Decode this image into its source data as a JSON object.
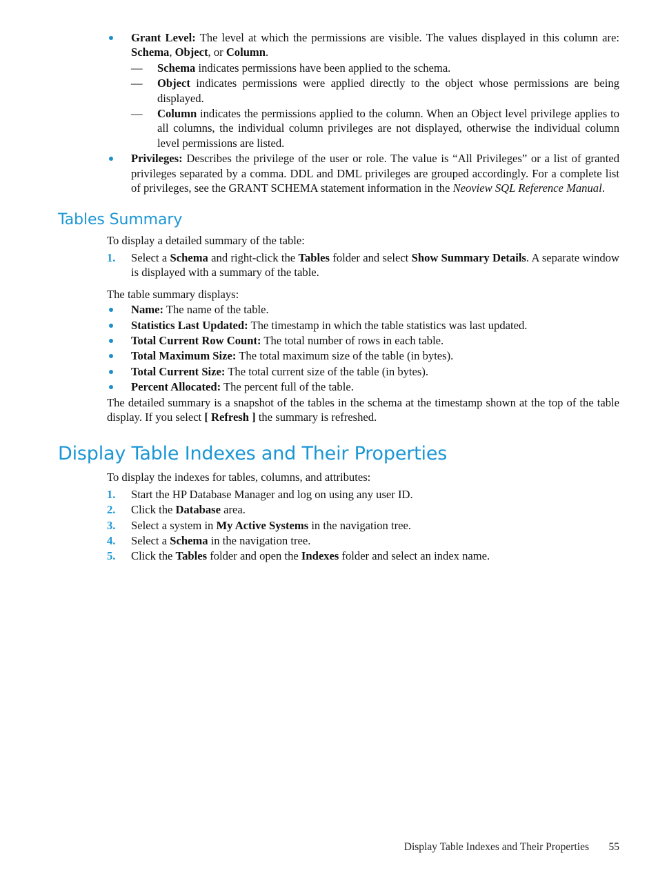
{
  "colors": {
    "heading": "#1b96d4",
    "bullet": "#1b8fcc",
    "number": "#1b96d4",
    "body_text": "#111111"
  },
  "section_permissions": {
    "bullets": [
      {
        "term": "Grant Level:",
        "text_1": " The level at which the permissions are visible. The values displayed in this column are: ",
        "bold_1": "Schema",
        "text_2": ", ",
        "bold_2": "Object",
        "text_3": ", or ",
        "bold_3": "Column",
        "text_4": "."
      }
    ],
    "sub_bullets": [
      {
        "marker": "—",
        "term": "Schema",
        "text": " indicates permissions have been applied to the schema."
      },
      {
        "marker": "—",
        "term": "Object",
        "text": " indicates permissions were applied directly to the object whose permissions are being displayed."
      },
      {
        "marker": "—",
        "term": "Column",
        "text": " indicates the permissions applied to the column. When an Object level privilege applies to all columns, the individual column privileges are not displayed, otherwise the individual column level permissions are listed."
      }
    ],
    "privileges_bullet": {
      "term": "Privileges:",
      "text_1": " Describes the privilege of the user or role. The value is “All Privileges” or a list of granted privileges separated by a comma. DDL and DML privileges are grouped accordingly. For a complete list of privileges, see the GRANT SCHEMA statement information in the ",
      "italic_1": "Neoview SQL Reference Manual",
      "text_2": "."
    }
  },
  "tables_summary": {
    "heading": "Tables Summary",
    "intro": "To display a detailed summary of the table:",
    "steps": [
      {
        "marker": "1.",
        "text_1": "Select a ",
        "bold_1": "Schema",
        "text_2": " and right-click the ",
        "bold_2": "Tables",
        "text_3": " folder and select ",
        "bold_3": "Show Summary Details",
        "text_4": ". A separate window is displayed with a summary of the table."
      }
    ],
    "displays_intro": "The table summary displays:",
    "display_items": [
      {
        "term": "Name:",
        "text": " The name of the table."
      },
      {
        "term": "Statistics Last Updated:",
        "text": " The timestamp in which the table statistics was last updated."
      },
      {
        "term": "Total Current Row Count:",
        "text": " The total number of rows in each table."
      },
      {
        "term": "Total Maximum Size:",
        "text": " The total maximum size of the table (in bytes)."
      },
      {
        "term": "Total Current Size:",
        "text": " The total current size of the table (in bytes)."
      },
      {
        "term": "Percent Allocated:",
        "text": " The percent full of the table."
      }
    ],
    "outro": {
      "text_1": "The detailed summary is a snapshot of the tables in the schema at the timestamp shown at the top of the table display. If you select ",
      "bold_1": "[ Refresh ]",
      "text_2": " the summary is refreshed."
    }
  },
  "display_indexes": {
    "heading": "Display Table Indexes and Their Properties",
    "intro": "To display the indexes for tables, columns, and attributes:",
    "steps": [
      {
        "marker": "1.",
        "text_1": "Start the HP Database Manager and log on using any user ID.",
        "bold_1": "",
        "text_2": ""
      },
      {
        "marker": "2.",
        "text_1": "Click the ",
        "bold_1": "Database",
        "text_2": " area."
      },
      {
        "marker": "3.",
        "text_1": "Select a system in ",
        "bold_1": "My Active Systems",
        "text_2": " in the navigation tree."
      },
      {
        "marker": "4.",
        "text_1": "Select a ",
        "bold_1": "Schema",
        "text_2": " in the navigation tree."
      },
      {
        "marker": "5.",
        "text_1": "Click the ",
        "bold_1": "Tables",
        "text_2": " folder and open the ",
        "bold_2": "Indexes",
        "text_3": " folder and select an index name."
      }
    ]
  },
  "footer": {
    "title": "Display Table Indexes and Their Properties",
    "page_number": "55"
  }
}
